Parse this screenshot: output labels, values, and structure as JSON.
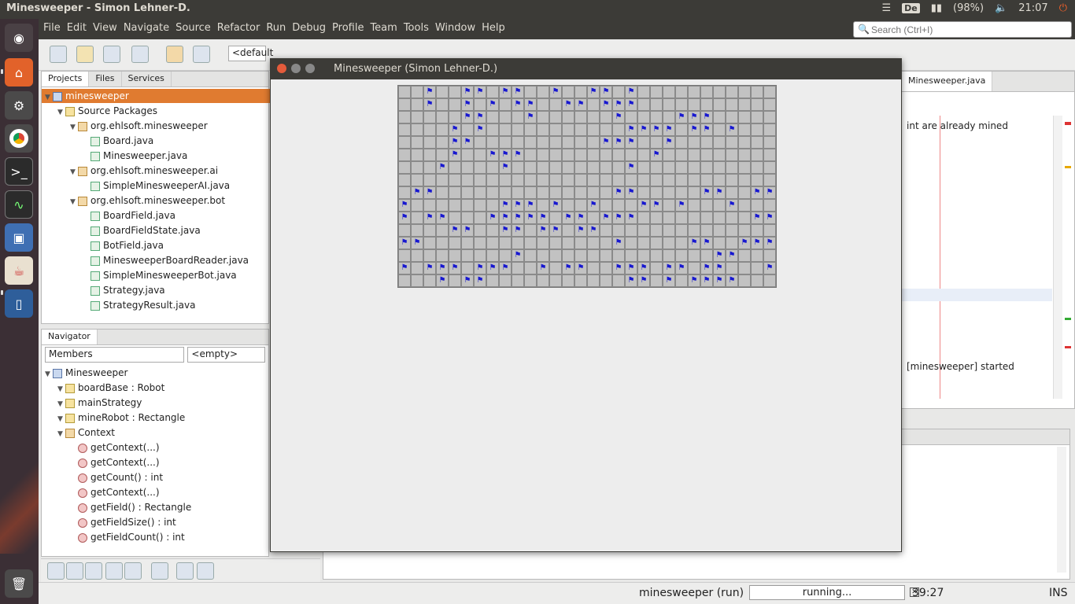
{
  "system": {
    "window_title": "Minesweeper - Simon Lehner-D.",
    "keyboard_layout": "De",
    "battery": "(98%)",
    "clock": "21:07"
  },
  "menubar": {
    "items": [
      "File",
      "Edit",
      "View",
      "Navigate",
      "Source",
      "Refactor",
      "Run",
      "Debug",
      "Profile",
      "Team",
      "Tools",
      "Window",
      "Help"
    ],
    "search_placeholder": "Search (Ctrl+I)"
  },
  "toolbar": {
    "config_value": "<default"
  },
  "projects_panel": {
    "tabs": [
      "Projects",
      "Files",
      "Services"
    ],
    "rows": [
      {
        "label": "minesweeper",
        "depth": 0,
        "icon": "proj",
        "selected": true
      },
      {
        "label": "Source Packages",
        "depth": 1,
        "icon": "fld"
      },
      {
        "label": "org.ehlsoft.minesweeper",
        "depth": 2,
        "icon": "pkg"
      },
      {
        "label": "Board.java",
        "depth": 3,
        "icon": "file"
      },
      {
        "label": "Minesweeper.java",
        "depth": 3,
        "icon": "file"
      },
      {
        "label": "org.ehlsoft.minesweeper.ai",
        "depth": 2,
        "icon": "pkg"
      },
      {
        "label": "SimpleMinesweeperAI.java",
        "depth": 3,
        "icon": "file"
      },
      {
        "label": "org.ehlsoft.minesweeper.bot",
        "depth": 2,
        "icon": "pkg"
      },
      {
        "label": "BoardField.java",
        "depth": 3,
        "icon": "file"
      },
      {
        "label": "BoardFieldState.java",
        "depth": 3,
        "icon": "file"
      },
      {
        "label": "BotField.java",
        "depth": 3,
        "icon": "file"
      },
      {
        "label": "MinesweeperBoardReader.java",
        "depth": 3,
        "icon": "file"
      },
      {
        "label": "SimpleMinesweeperBot.java",
        "depth": 3,
        "icon": "file"
      },
      {
        "label": "Strategy.java",
        "depth": 3,
        "icon": "file"
      },
      {
        "label": "StrategyResult.java",
        "depth": 3,
        "icon": "file"
      }
    ]
  },
  "navigator_panel": {
    "tabs": [
      "Navigator"
    ],
    "members_label": "Members",
    "empty_label": "<empty>",
    "rows": [
      {
        "label": "Minesweeper",
        "depth": 0,
        "icon": "proj"
      },
      {
        "label": "boardBase : Robot",
        "depth": 1,
        "icon": "fld"
      },
      {
        "label": "mainStrategy",
        "depth": 1,
        "icon": "fld"
      },
      {
        "label": "mineRobot : Rectangle",
        "depth": 1,
        "icon": "fld"
      },
      {
        "label": "Context",
        "depth": 1,
        "icon": "pkg"
      },
      {
        "label": "getContext(...)",
        "depth": 2,
        "icon": "mth"
      },
      {
        "label": "getContext(...)",
        "depth": 2,
        "icon": "mth"
      },
      {
        "label": "getCount() : int",
        "depth": 2,
        "icon": "mth"
      },
      {
        "label": "getContext(...)",
        "depth": 2,
        "icon": "mth"
      },
      {
        "label": "getField() : Rectangle",
        "depth": 2,
        "icon": "mth"
      },
      {
        "label": "getFieldSize() : int",
        "depth": 2,
        "icon": "mth"
      },
      {
        "label": "getFieldCount() : int",
        "depth": 2,
        "icon": "mth"
      }
    ]
  },
  "minesweeper_window": {
    "title": "Minesweeper (Simon Lehner-D.)",
    "board": [
      "..F..FF.FF..F..FF.F...........",
      "..F..F.F.FF..FF.FFF...........",
      ".....FF...F......F....FFF.....",
      "....F.F...........FFFF.FF.F...",
      "....FF..........FFF..F........",
      "....F..FFF..........F.........",
      "...F....F.........F...........",
      "..............................",
      ".FF..............FF.....FF..FF",
      "F.......FFF.F..F...FF.F...F...",
      "F.FF...FFFFF.FF.FFF.........FF",
      "....FF..FF.FF.FF..............",
      "FF...............F.....FF..FFF",
      ".........F...............FF...",
      "F.FFF.FFF..F.FF..FFF.FF.FF...F",
      "...F.FF...........FF.F.FFFF..."
    ]
  },
  "editor_panel": {
    "tab_label": "Minesweeper.java",
    "snippet_top": "int are already mined",
    "snippet_bottom": "[minesweeper] started"
  },
  "statusbar": {
    "run_label": "minesweeper (run)",
    "progress_label": "running...",
    "position": "39:27",
    "mode": "INS"
  }
}
